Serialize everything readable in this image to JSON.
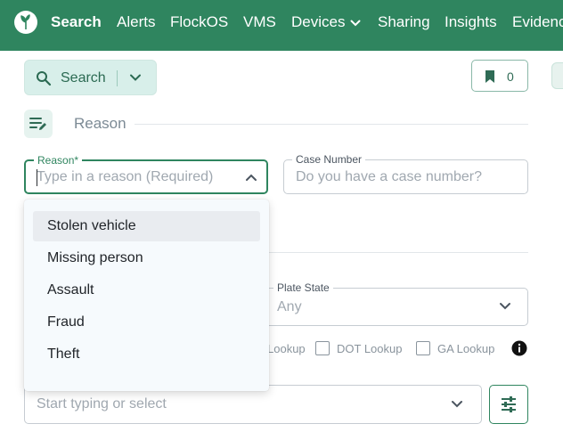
{
  "nav": {
    "items": [
      {
        "label": "Search",
        "active": true
      },
      {
        "label": "Alerts"
      },
      {
        "label": "FlockOS"
      },
      {
        "label": "VMS"
      },
      {
        "label": "Devices",
        "has_dropdown": true
      },
      {
        "label": "Sharing"
      },
      {
        "label": "Insights"
      },
      {
        "label": "Evidence"
      }
    ],
    "logo_icon": "flock-logo-icon",
    "background": "#2f855f"
  },
  "toolbar": {
    "search_label": "Search",
    "bookmark_count": "0"
  },
  "reason_section": {
    "title": "Reason",
    "reason_field": {
      "label": "Reason",
      "required_mark": "*",
      "placeholder": "Type in a reason (Required)",
      "value": ""
    },
    "case_field": {
      "label": "Case Number",
      "placeholder": "Do you have a case number?",
      "value": ""
    }
  },
  "reason_dropdown": {
    "options": [
      "Stolen vehicle",
      "Missing person",
      "Assault",
      "Fraud",
      "Theft"
    ],
    "highlighted_index": 0
  },
  "vehicle_section": {
    "plate_state": {
      "label": "Plate State",
      "value": "Any"
    },
    "lookups": [
      {
        "label": "Lookup",
        "checked": false
      },
      {
        "label": "DOT Lookup",
        "checked": false
      },
      {
        "label": "GA Lookup",
        "checked": false
      }
    ],
    "start_field": {
      "placeholder": "Start typing or select"
    }
  },
  "colors": {
    "accent": "#2f855f",
    "accent_light": "#d8efea"
  }
}
